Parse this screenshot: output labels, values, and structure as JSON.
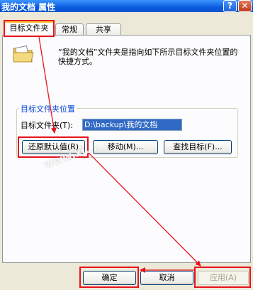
{
  "window": {
    "title": "我的文档 属性",
    "help_glyph": "?",
    "close_glyph": "✕"
  },
  "tabs": [
    {
      "label": "目标文件夹",
      "active": true
    },
    {
      "label": "常规",
      "active": false
    },
    {
      "label": "共享",
      "active": false
    }
  ],
  "description": "“我的文档”文件夹是指向如下所示目标文件夹位置的快捷方式。",
  "target_group": {
    "title": "目标文件夹位置",
    "field_label": "目标文件夹(T):",
    "field_value": "D:\\backup\\我的文档",
    "buttons": {
      "restore": "还原默认值(R)",
      "move": "移动(M)...",
      "find": "查找目标(F)..."
    }
  },
  "dialog_buttons": {
    "ok": "确定",
    "cancel": "取消",
    "apply": "应用(A)"
  },
  "watermark": "www.xi...",
  "colors": {
    "highlight": "#E8121C",
    "title_bar": "#0A5CDE",
    "selected_text_bg": "#316AC5"
  }
}
